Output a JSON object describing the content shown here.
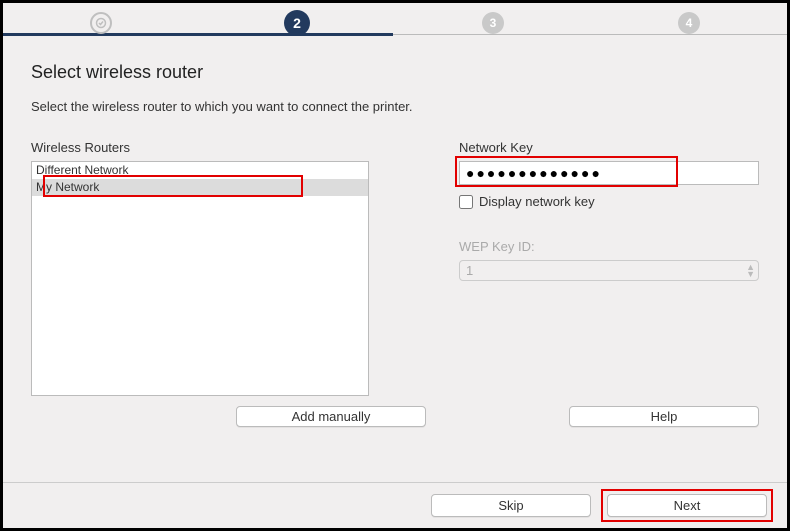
{
  "stepper": {
    "step2": "2",
    "step3": "3",
    "step4": "4"
  },
  "title": "Select wireless router",
  "instruction": "Select the wireless router to which you want to connect the printer.",
  "labels": {
    "routers": "Wireless Routers",
    "network_key": "Network Key",
    "display_key": "Display network key",
    "wep_id": "WEP Key ID:"
  },
  "routers": {
    "items": [
      {
        "name": "Different Network",
        "selected": false
      },
      {
        "name": "My Network",
        "selected": true
      }
    ]
  },
  "network_key_value": "●●●●●●●●●●●●●",
  "wep_value": "1",
  "buttons": {
    "add_manually": "Add manually",
    "help": "Help",
    "skip": "Skip",
    "next": "Next"
  }
}
